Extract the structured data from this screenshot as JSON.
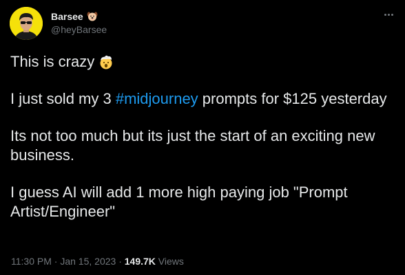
{
  "user": {
    "display_name": "Barsee",
    "name_emoji": "dog-face-emoji",
    "handle": "@heyBarsee"
  },
  "tweet": {
    "line1_text": "This is crazy",
    "line1_emoji": "exploding-head-emoji",
    "para2_prefix": "I just sold my 3 ",
    "hashtag": "#midjourney",
    "para2_suffix": " prompts for $125 yesterday",
    "para3": "Its not too much but its just the start of an exciting new business.",
    "para4": "I guess AI will add 1 more high paying job \"Prompt Artist/Engineer\""
  },
  "meta": {
    "time": "11:30 PM",
    "sep1": " · ",
    "date": "Jan 15, 2023",
    "sep2": " · ",
    "views_count": "149.7K",
    "views_label": " Views"
  },
  "colors": {
    "background": "#000000",
    "text": "#e7e9ea",
    "secondary": "#71767b",
    "link": "#1d9bf0",
    "avatar_bg": "#f5e10a"
  }
}
